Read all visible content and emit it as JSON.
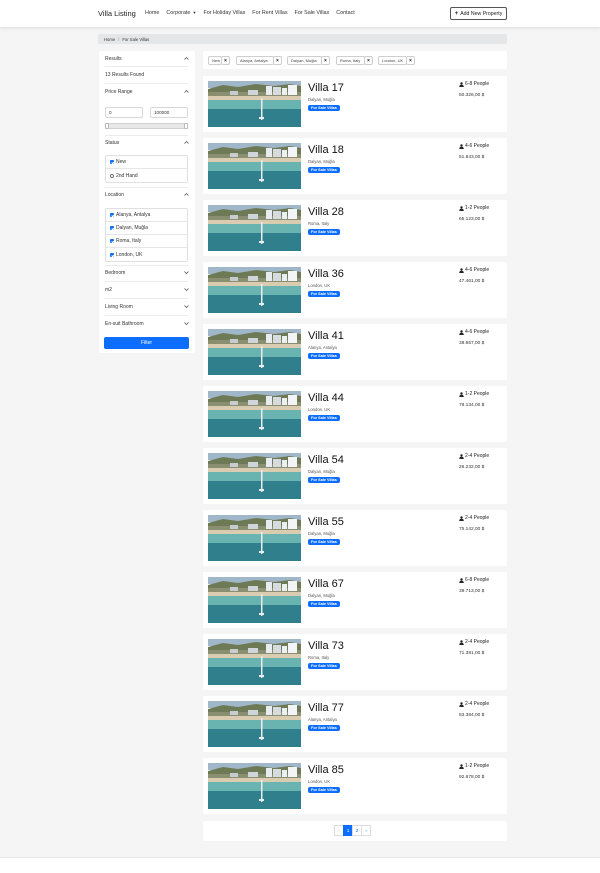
{
  "nav": {
    "brand": "Villa Listing",
    "links": [
      "Home",
      "Corporate",
      "For Holiday Villas",
      "For Rent Villas",
      "For Sale Villas",
      "Contact"
    ],
    "add_button": "Add New Property"
  },
  "breadcrumb": {
    "home": "Home",
    "current": "For Sale Villas"
  },
  "sidebar": {
    "results_label": "Results",
    "results_count": "13 Results Found",
    "price_label": "Price Range",
    "price_min": "0",
    "price_max": "100000",
    "status_label": "Status",
    "status_options": [
      {
        "label": "New",
        "checked": true
      },
      {
        "label": "2nd Hand",
        "checked": false
      }
    ],
    "location_label": "Location",
    "location_options": [
      "Alanya, Antalya",
      "Dalyan, Muğla",
      "Roma, Italy",
      "London, UK"
    ],
    "collapsed_sections": [
      "Bedroom",
      "m2",
      "Living Room",
      "En-suit Bathroom"
    ],
    "filter_button": "Filter"
  },
  "chips": [
    "New",
    "Alanya, Antalya",
    "Dalyan, Muğla",
    "Roma, Italy",
    "London, UK"
  ],
  "badge_label": "For Sale Villas",
  "villas": [
    {
      "title": "Villa 17",
      "location": "Dalyan, Muğla",
      "people": "6-8 People",
      "price": "50.326,00 $"
    },
    {
      "title": "Villa 18",
      "location": "Dalyan, Muğla",
      "people": "4-6 People",
      "price": "51.843,00 $"
    },
    {
      "title": "Villa 28",
      "location": "Roma, Italy",
      "people": "1-2 People",
      "price": "65.123,00 $"
    },
    {
      "title": "Villa 36",
      "location": "London, UK",
      "people": "4-6 People",
      "price": "47.461,00 $"
    },
    {
      "title": "Villa 41",
      "location": "Alanya, Antalya",
      "people": "4-6 People",
      "price": "38.657,00 $"
    },
    {
      "title": "Villa 44",
      "location": "London, UK",
      "people": "1-2 People",
      "price": "78.134,00 $"
    },
    {
      "title": "Villa 54",
      "location": "Dalyan, Muğla",
      "people": "2-4 People",
      "price": "26.232,00 $"
    },
    {
      "title": "Villa 55",
      "location": "Dalyan, Muğla",
      "people": "2-4 People",
      "price": "75.142,00 $"
    },
    {
      "title": "Villa 67",
      "location": "Dalyan, Muğla",
      "people": "6-8 People",
      "price": "39.713,00 $"
    },
    {
      "title": "Villa 73",
      "location": "Roma, Italy",
      "people": "2-4 People",
      "price": "71.381,00 $"
    },
    {
      "title": "Villa 77",
      "location": "Alanya, Antalya",
      "people": "2-4 People",
      "price": "83.384,00 $"
    },
    {
      "title": "Villa 85",
      "location": "London, UK",
      "people": "1-2 People",
      "price": "92.678,00 $"
    }
  ],
  "pagination": {
    "prev": "‹",
    "pages": [
      "1",
      "2"
    ],
    "next": "›",
    "active": "1"
  },
  "colors": {
    "primary": "#0d6efd",
    "background": "#f4f5f4"
  },
  "icons": {
    "person": "person-icon",
    "close": "close-icon",
    "chevron": "chevron-icon",
    "plus": "plus-icon"
  }
}
